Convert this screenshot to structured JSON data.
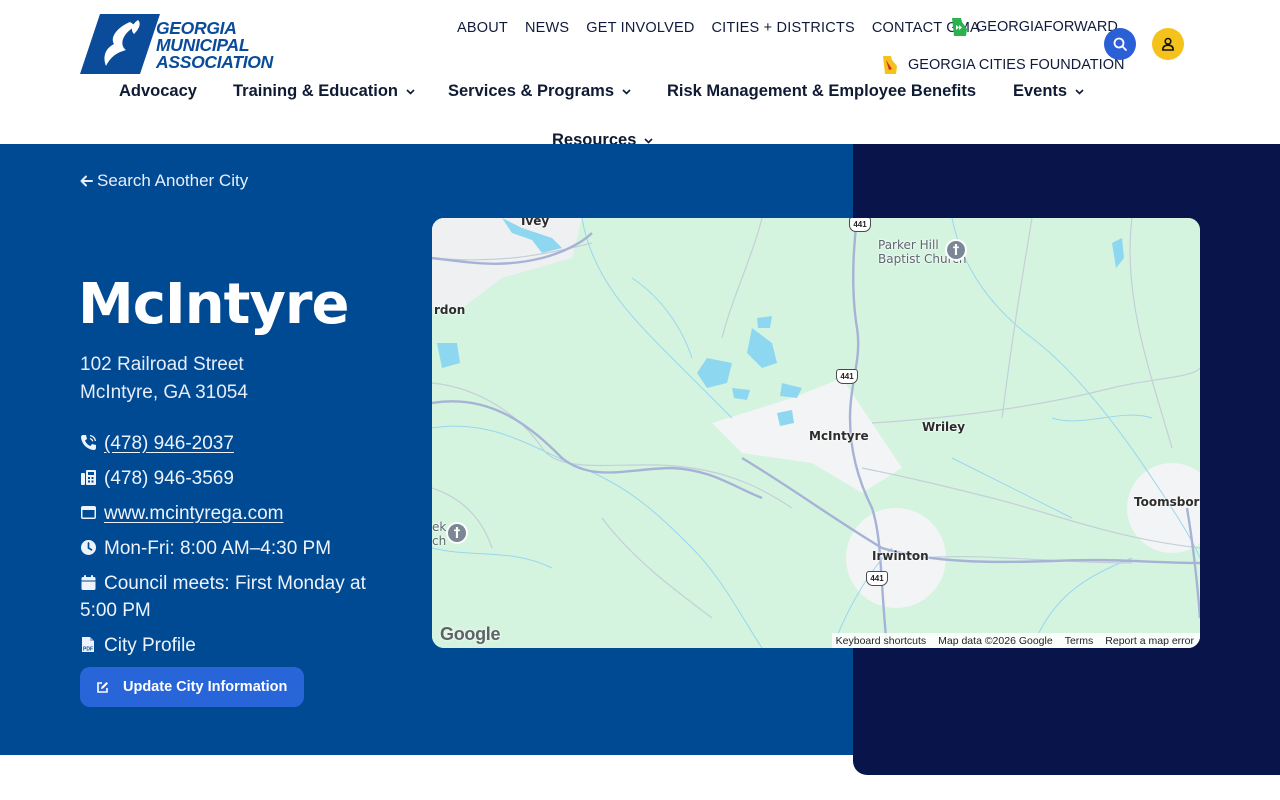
{
  "brand": {
    "logo_line1": "GEORGIA",
    "logo_line2": "MUNICIPAL",
    "logo_line3": "ASSOCIATION",
    "primary_color": "#004a94",
    "dark_color": "#09154a",
    "accent_blue": "#2765d8",
    "accent_yellow": "#f4c21a"
  },
  "utility_nav": {
    "items": [
      "ABOUT",
      "NEWS",
      "GET INVOLVED",
      "CITIES + DISTRICTS",
      "CONTACT GMA"
    ],
    "georgia_forward": "GEORGIAFORWARD",
    "georgia_cities_foundation": "GEORGIA CITIES FOUNDATION"
  },
  "main_nav": {
    "items": [
      {
        "label": "Advocacy",
        "dropdown": false
      },
      {
        "label": "Training & Education",
        "dropdown": true
      },
      {
        "label": "Services & Programs",
        "dropdown": true
      },
      {
        "label": "Risk Management & Employee Benefits",
        "dropdown": false
      },
      {
        "label": "Events",
        "dropdown": true
      },
      {
        "label": "Resources",
        "dropdown": true
      }
    ]
  },
  "header_icons": {
    "search": "search-icon",
    "user": "user-icon"
  },
  "city": {
    "back_link": "Search Another City",
    "name": "McIntyre",
    "address_line1": "102 Railroad Street",
    "address_line2": "McIntyre, GA 31054",
    "phone": "(478) 946-2037",
    "fax": "(478) 946-3569",
    "website": "www.mcintyrega.com",
    "hours": "Mon-Fri: 8:00 AM–4:30 PM",
    "council_line1": "Council meets: First Monday at",
    "council_line2": "5:00 PM",
    "profile": "City Profile",
    "update_button": "Update City Information"
  },
  "map": {
    "labels": {
      "ivey": "Ivey",
      "gordon": "rdon",
      "parker_hill_1": "Parker Hill",
      "parker_hill_2": "Baptist Church",
      "mcintyre": "McIntyre",
      "wriley": "Wriley",
      "irwinton": "Irwinton",
      "toomsboro": "Toomsboro",
      "creek_church_1": "ek",
      "creek_church_2": "ch"
    },
    "route_shield": "441",
    "google": "Google",
    "footer": {
      "shortcuts": "Keyboard shortcuts",
      "data": "Map data ©2026 Google",
      "terms": "Terms",
      "report": "Report a map error"
    }
  }
}
